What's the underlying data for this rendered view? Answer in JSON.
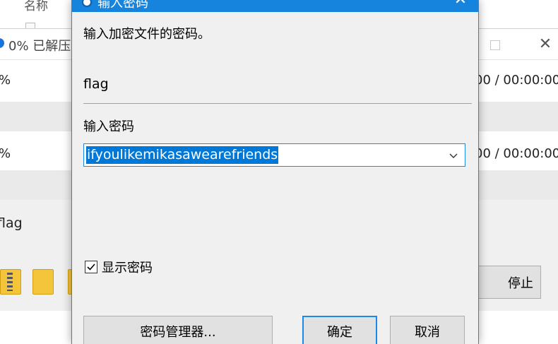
{
  "background": {
    "explorer": {
      "column_header": "名称"
    },
    "progress_window": {
      "title": "0% 已解压",
      "rows": [
        {
          "percent": "%",
          "time": "00 / 00:00:00"
        },
        {
          "percent": "%",
          "time": "00 / 00:00:00"
        }
      ],
      "filename": "flag",
      "stop_label": "停止"
    }
  },
  "dialog": {
    "title": "输入密码",
    "prompt": "输入加密文件的密码。",
    "filename": "flag",
    "password_label": "输入密码",
    "password_value": "ifyoulikemikasawearefriends",
    "show_password_label": "显示密码",
    "show_password_checked": true,
    "buttons": {
      "manager": "密码管理器...",
      "ok": "确定",
      "cancel": "取消"
    }
  },
  "colors": {
    "accent": "#1683dc",
    "selection": "#0078d7",
    "dialog_bg": "#f0f0f0"
  },
  "icons": [
    "close-icon",
    "maximize-icon",
    "app-icon",
    "folder-icon",
    "archive-icon",
    "chevron-down-icon",
    "checkmark-icon"
  ]
}
